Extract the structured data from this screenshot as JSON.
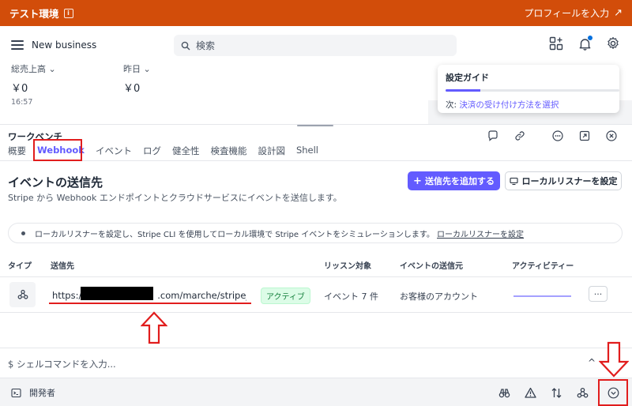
{
  "env_bar": {
    "title": "テスト環境",
    "info_glyph": "i",
    "profile_link": "プロフィールを入力",
    "arrow": "↗"
  },
  "header": {
    "business": "New business",
    "search_placeholder": "検索"
  },
  "dashboard": {
    "gross_label": "総売上高",
    "gross_value": "￥0",
    "gross_time": "16:57",
    "yesterday_label": "昨日",
    "yesterday_value": "￥0"
  },
  "setup_guide": {
    "title": "設定ガイド",
    "progress": 0.2,
    "next_prefix": "次:",
    "next_link": "決済の受け付け方法を選択"
  },
  "workbench": {
    "title": "ワークベンチ",
    "tabs": [
      "概要",
      "Webhook",
      "イベント",
      "ログ",
      "健全性",
      "検査機能",
      "設計図",
      "Shell"
    ],
    "active_tab": "Webhook"
  },
  "section": {
    "title": "イベントの送信先",
    "description": "Stripe から Webhook エンドポイントとクラウドサービスにイベントを送信します。",
    "add_button": "送信先を追加する",
    "add_icon": "+",
    "local_button": "ローカルリスナーを設定"
  },
  "notice": {
    "text": "ローカルリスナーを設定し、Stripe CLI を使用してローカル環境で Stripe イベントをシミュレーションします。",
    "link": "ローカルリスナーを設定"
  },
  "table": {
    "headers": [
      "タイプ",
      "送信先",
      "リッスン対象",
      "イベントの送信元",
      "アクティビティー"
    ],
    "row": {
      "url_prefix": "https://",
      "url_suffix": ".com/marche/stripe_pay",
      "status": "アクティブ",
      "listen": "イベント 7 件",
      "source": "お客様のアカウント",
      "more": "···"
    }
  },
  "shell": {
    "prompt": "$ シェルコマンドを入力...",
    "caret": "^"
  },
  "dev_bar": {
    "label": "開発者"
  },
  "colors": {
    "env_orange": "#d24d0a",
    "accent": "#635bff",
    "annotation_red": "#e11d1d"
  }
}
